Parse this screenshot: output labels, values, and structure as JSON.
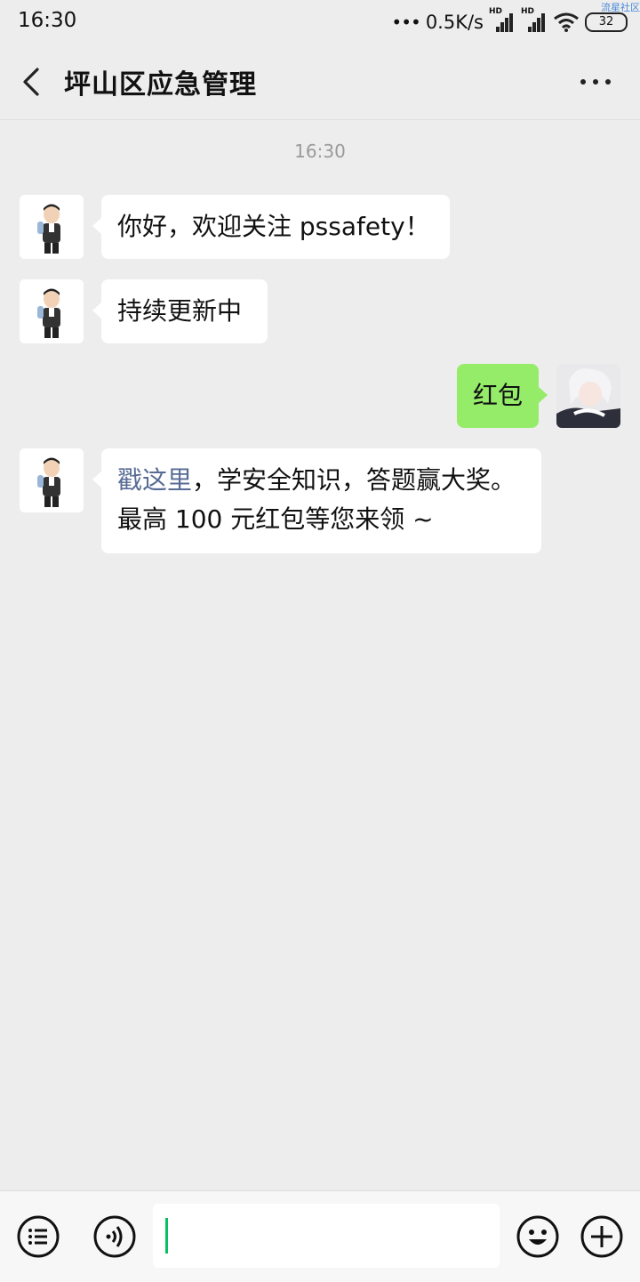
{
  "status_bar": {
    "time": "16:30",
    "network_speed": "0.5K/s",
    "signal_label_1": "HD",
    "signal_label_2": "HD",
    "battery": "32",
    "watermark": "流星社区",
    "icons": [
      "signal-hd-icon",
      "signal-hd-icon",
      "wifi-icon",
      "battery-icon"
    ]
  },
  "header": {
    "title": "坪山区应急管理",
    "back_icon": "chevron-left-icon",
    "more_icon": "more-dots-icon"
  },
  "chat": {
    "timestamp": "16:30",
    "messages": [
      {
        "side": "left",
        "text": "你好，欢迎关注 pssafety！"
      },
      {
        "side": "left",
        "text": "持续更新中"
      },
      {
        "side": "right",
        "text": "红包"
      },
      {
        "side": "left",
        "link_text": "戳这里",
        "line1_rest": "，学安全知识，答题赢大奖。",
        "line2": "最高 100 元红包等您来领 ~"
      }
    ]
  },
  "input_bar": {
    "value": "",
    "icons": [
      "menu-list-icon",
      "voice-icon",
      "emoji-icon",
      "plus-icon"
    ]
  },
  "colors": {
    "background": "#ededed",
    "bubble_self": "#95ec69",
    "bubble_other": "#ffffff",
    "link": "#576b95",
    "caret": "#07c160"
  }
}
